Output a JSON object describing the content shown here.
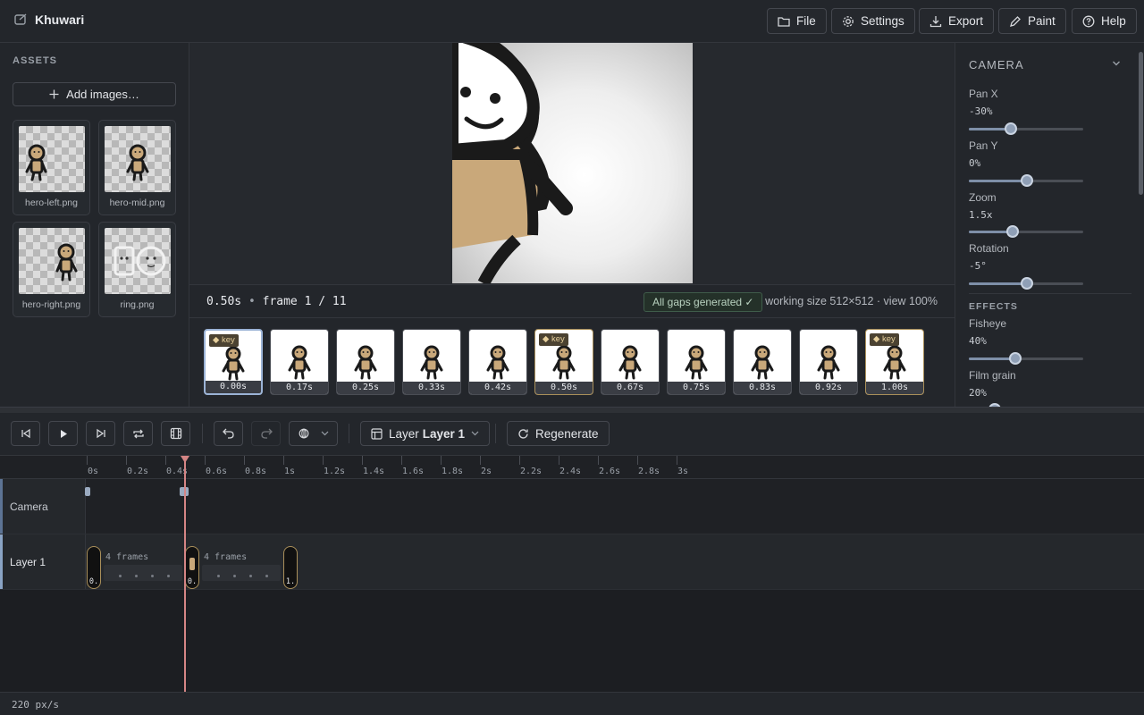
{
  "app": {
    "title": "Khuwari"
  },
  "topbar": {
    "buttons": [
      {
        "label": "File",
        "icon": "folder-icon"
      },
      {
        "label": "Settings",
        "icon": "gear-icon"
      },
      {
        "label": "Export",
        "icon": "download-icon"
      },
      {
        "label": "Paint",
        "icon": "pen-icon"
      },
      {
        "label": "Help",
        "icon": "help-icon"
      }
    ]
  },
  "assets": {
    "title": "ASSETS",
    "add_label": "Add images…",
    "items": [
      {
        "name": "hero-left.png"
      },
      {
        "name": "hero-mid.png"
      },
      {
        "name": "hero-right.png"
      },
      {
        "name": "ring.png"
      }
    ]
  },
  "infobar": {
    "time": "0.50s",
    "frame": "frame 1 / 11",
    "gaps_badge": "All gaps generated ✓",
    "working": "working size 512×512 · view 100%"
  },
  "frames": [
    {
      "time": "0.00s",
      "key": true,
      "selected": true
    },
    {
      "time": "0.17s",
      "key": false
    },
    {
      "time": "0.25s",
      "key": false
    },
    {
      "time": "0.33s",
      "key": false
    },
    {
      "time": "0.42s",
      "key": false
    },
    {
      "time": "0.50s",
      "key": true
    },
    {
      "time": "0.67s",
      "key": false
    },
    {
      "time": "0.75s",
      "key": false
    },
    {
      "time": "0.83s",
      "key": false
    },
    {
      "time": "0.92s",
      "key": false
    },
    {
      "time": "1.00s",
      "key": true
    }
  ],
  "frame_key_label": "◆ key",
  "camera": {
    "title": "CAMERA",
    "controls": [
      {
        "label": "Pan X",
        "value": "-30%",
        "level": 0.37
      },
      {
        "label": "Pan Y",
        "value": "0%",
        "level": 0.51
      },
      {
        "label": "Zoom",
        "value": "1.5x",
        "level": 0.38
      },
      {
        "label": "Rotation",
        "value": "-5°",
        "level": 0.51
      }
    ]
  },
  "effects": {
    "title": "EFFECTS",
    "controls": [
      {
        "label": "Fisheye",
        "value": "40%",
        "level": 0.41
      },
      {
        "label": "Film grain",
        "value": "20%",
        "level": 0.23
      }
    ]
  },
  "toolbar": {
    "layer_prefix": "Layer",
    "layer_name": "Layer 1",
    "regenerate": "Regenerate"
  },
  "ruler": {
    "labels": [
      "0s",
      "0.2s",
      "0.4s",
      "0.6s",
      "0.8s",
      "1s",
      "1.2s",
      "1.4s",
      "1.6s",
      "1.8s",
      "2s",
      "2.2s",
      "2.4s",
      "2.6s",
      "2.8s",
      "3s"
    ]
  },
  "tracks": {
    "camera_label": "Camera",
    "layer_label": "Layer 1",
    "clips": [
      {
        "time_label": "0."
      },
      {
        "time_label": "0."
      },
      {
        "time_label": "1."
      }
    ],
    "gaps": [
      {
        "label": "4 frames"
      },
      {
        "label": "4 frames"
      }
    ]
  },
  "status": {
    "zoom": "220 px/s"
  },
  "colors": {
    "accent": "#9bb3d6",
    "key": "#a98f5a",
    "playhead": "#d48585"
  }
}
